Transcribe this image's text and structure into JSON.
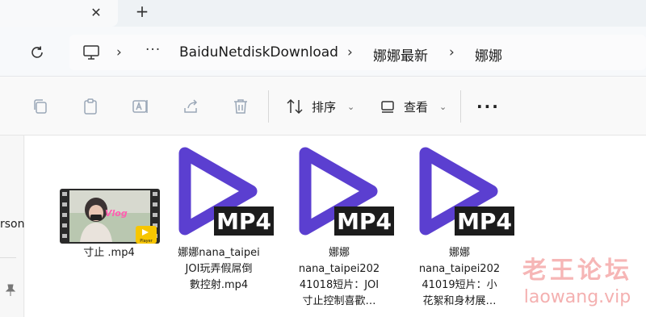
{
  "tabs": {
    "close_glyph": "✕",
    "new_glyph": "+"
  },
  "breadcrumb": {
    "overflow": "···",
    "items": [
      "BaiduNetdiskDownload",
      "娜娜最新",
      "娜娜"
    ],
    "separator": "›"
  },
  "toolbar": {
    "sort_label": "排序",
    "view_label": "查看",
    "more_label": "···"
  },
  "navpane": {
    "partial_label": "rson"
  },
  "files": [
    {
      "name": "寸止 .mp4",
      "type": "video-thumbnail",
      "badge": "Player",
      "thumb_text": "Vlog"
    },
    {
      "name": "娜娜nana_taipei\nJOI玩弄假屌倒\n數控射.mp4",
      "type": "mp4",
      "badge": "MP4"
    },
    {
      "name": "娜娜\nnana_taipei202\n41018短片：JOI\n寸止控制喜歡…",
      "type": "mp4",
      "badge": "MP4"
    },
    {
      "name": "娜娜\nnana_taipei202\n41019短片：小\n花絮和身材展…",
      "type": "mp4",
      "badge": "MP4"
    }
  ],
  "watermark": {
    "cn": "老王论坛",
    "en": "laowang.vip"
  },
  "colors": {
    "play_purple": "#5b3fd0",
    "badge_dark": "#1c1c1c",
    "watermark": "#f4b0b0"
  }
}
